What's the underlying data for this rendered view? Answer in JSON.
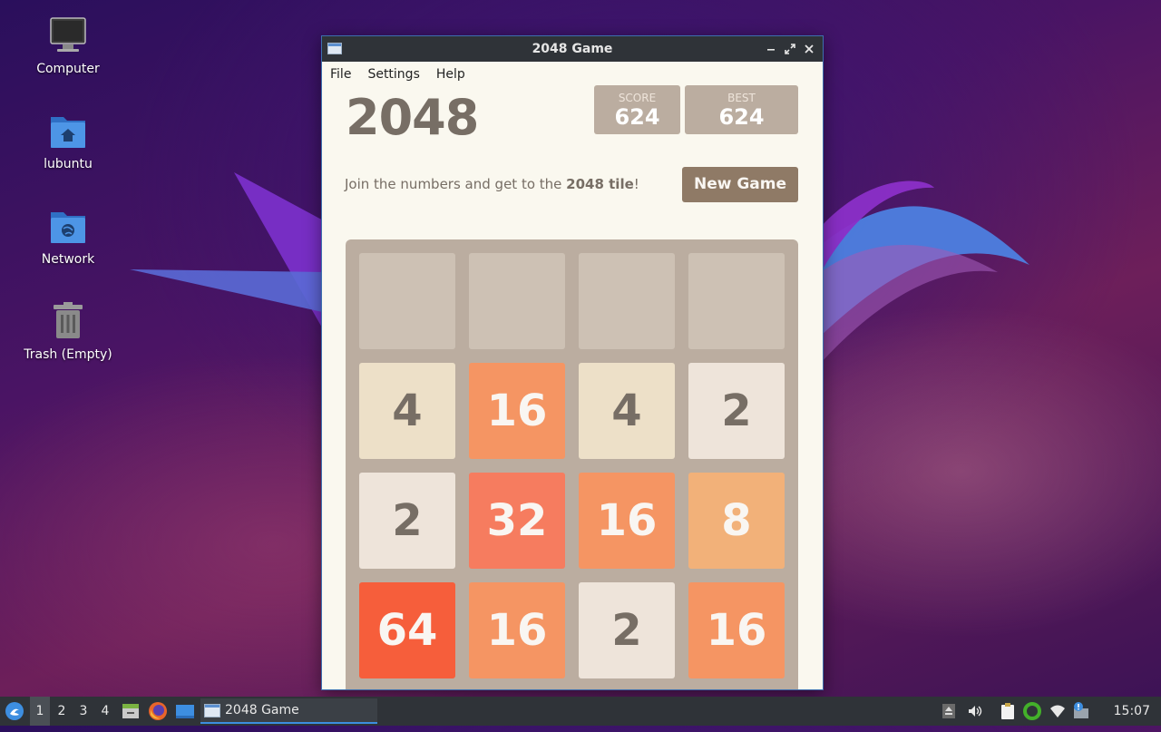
{
  "desktop": {
    "icons": [
      {
        "label": "Computer",
        "icon": "computer-icon"
      },
      {
        "label": "lubuntu",
        "icon": "home-folder-icon"
      },
      {
        "label": "Network",
        "icon": "network-folder-icon"
      },
      {
        "label": "Trash (Empty)",
        "icon": "trash-icon"
      }
    ]
  },
  "window": {
    "title": "2048 Game",
    "menu": [
      "File",
      "Settings",
      "Help"
    ],
    "controls": [
      "minimize-icon",
      "maximize-icon",
      "close-icon"
    ]
  },
  "game": {
    "title": "2048",
    "score_label": "SCORE",
    "score": "624",
    "best_label": "BEST",
    "best": "624",
    "intro_prefix": "Join the numbers and get to the ",
    "intro_bold": "2048 tile",
    "intro_suffix": "!",
    "new_game_label": "New Game",
    "grid": [
      [
        0,
        0,
        0,
        0
      ],
      [
        4,
        16,
        4,
        2
      ],
      [
        2,
        32,
        16,
        8
      ],
      [
        64,
        16,
        2,
        16
      ]
    ],
    "tile_colors": {
      "0": "#cdc1b4",
      "2": "#eee4da",
      "4": "#ede0c8",
      "8": "#f2b179",
      "16": "#f59563",
      "32": "#f67c5f",
      "64": "#f65e3b"
    }
  },
  "taskbar": {
    "workspaces": [
      "1",
      "2",
      "3",
      "4"
    ],
    "active_workspace": "1",
    "launchers": [
      "start-menu-icon",
      "file-manager-icon",
      "firefox-icon",
      "show-desktop-icon"
    ],
    "task_label": "2048 Game",
    "tray": [
      "eject-icon",
      "volume-icon",
      "clipboard-icon",
      "update-ring-icon",
      "wifi-icon",
      "notification-icon"
    ],
    "clock": "15:07"
  }
}
